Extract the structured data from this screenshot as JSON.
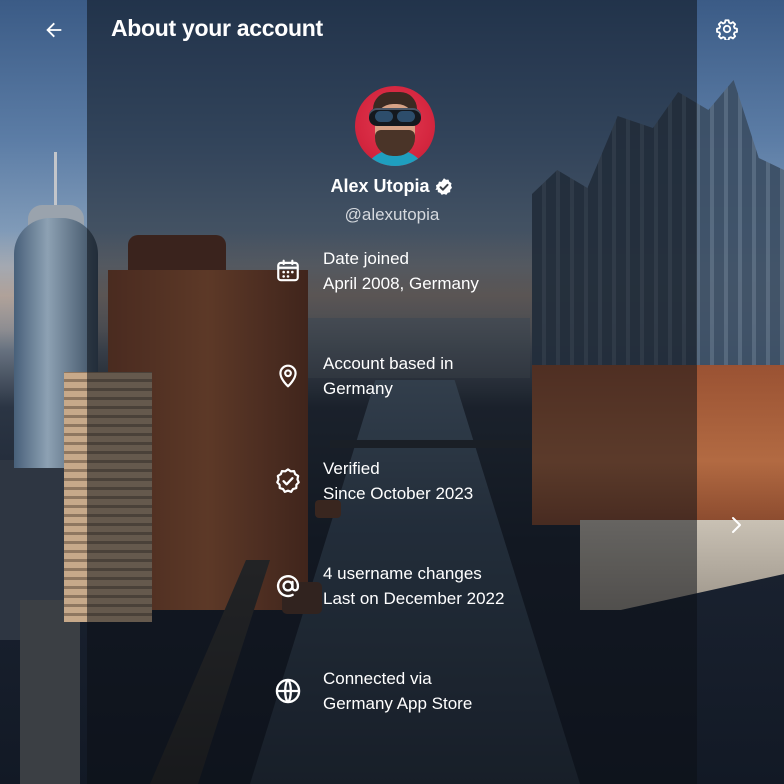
{
  "header": {
    "title": "About your account",
    "back_icon": "arrow-left-icon",
    "settings_icon": "gear-icon"
  },
  "profile": {
    "name": "Alex Utopia",
    "handle": "@alexutopia",
    "verified": true,
    "verified_badge_color": "#ffffff"
  },
  "rows": [
    {
      "icon": "calendar-icon",
      "title": "Date joined",
      "subtitle": "April 2008, Germany"
    },
    {
      "icon": "location-pin-icon",
      "title": "Account based in",
      "subtitle": "Germany"
    },
    {
      "icon": "verified-check-icon",
      "title": "Verified",
      "subtitle": "Since October 2023"
    },
    {
      "icon": "at-sign-icon",
      "title": "4 username changes",
      "subtitle": "Last on December 2022"
    },
    {
      "icon": "globe-icon",
      "title": "Connected via",
      "subtitle": "Germany App Store"
    }
  ],
  "colors": {
    "panel_overlay": "rgba(12,16,22,.52)",
    "text": "#ffffff",
    "handle_text": "#d5d9de",
    "avatar_background": "#d52740"
  },
  "background": {
    "description_icon": "harbor-cityscape-photo"
  },
  "carousel": {
    "next_icon": "chevron-right-icon"
  }
}
